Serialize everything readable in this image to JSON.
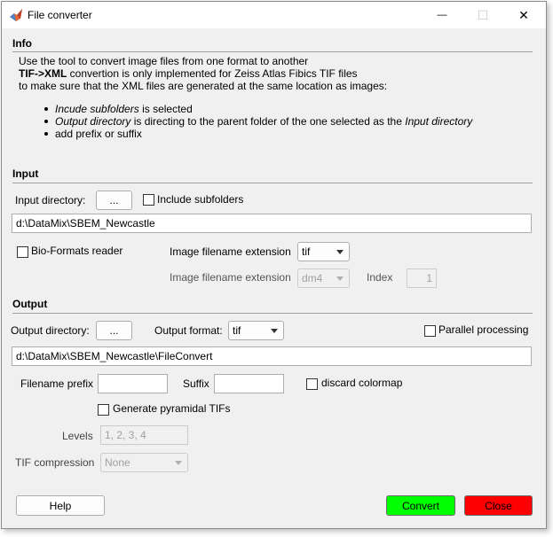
{
  "window": {
    "title": "File converter",
    "minimize": "—",
    "maximize": "☐",
    "close": "✕"
  },
  "info": {
    "heading": "Info",
    "line1": "Use the tool to convert image files from one format to another",
    "line2_bold": "TIF->XML",
    "line2_rest": " convertion is only implemented for Zeiss Atlas Fibics TIF files",
    "line3": "to make sure that the XML files are generated at the same location as images:",
    "bullet1_italic": "Incude subfolders",
    "bullet1_rest": " is selected",
    "bullet2_italic": "Output directory",
    "bullet2_mid": " is directing to the parent folder of the one selected as the ",
    "bullet2_italic2": "Input directory",
    "bullet3": "add prefix or suffix"
  },
  "input": {
    "heading": "Input",
    "dir_label": "Input directory:",
    "browse_label": "...",
    "include_subfolders": "Include subfolders",
    "path": "d:\\DataMix\\SBEM_Newcastle",
    "bioformats": "Bio-Formats reader",
    "ext_label": "Image filename extension",
    "ext_value": "tif",
    "ext2_label": "Image filename extension",
    "ext2_value": "dm4",
    "index_label": "Index",
    "index_value": "1"
  },
  "output": {
    "heading": "Output",
    "dir_label": "Output directory:",
    "browse_label": "...",
    "format_label": "Output format:",
    "format_value": "tif",
    "parallel": "Parallel processing",
    "path": "d:\\DataMix\\SBEM_Newcastle\\FileConvert",
    "prefix_label": "Filename prefix",
    "suffix_label": "Suffix",
    "discard_colormap": "discard colormap",
    "pyramidal": "Generate pyramidal TIFs",
    "levels_label": "Levels",
    "levels_value": "1, 2, 3, 4",
    "compression_label": "TIF compression",
    "compression_value": "None"
  },
  "footer": {
    "help": "Help",
    "convert": "Convert",
    "close": "Close"
  },
  "colors": {
    "convert": "#00ff00",
    "close": "#ff0000"
  }
}
